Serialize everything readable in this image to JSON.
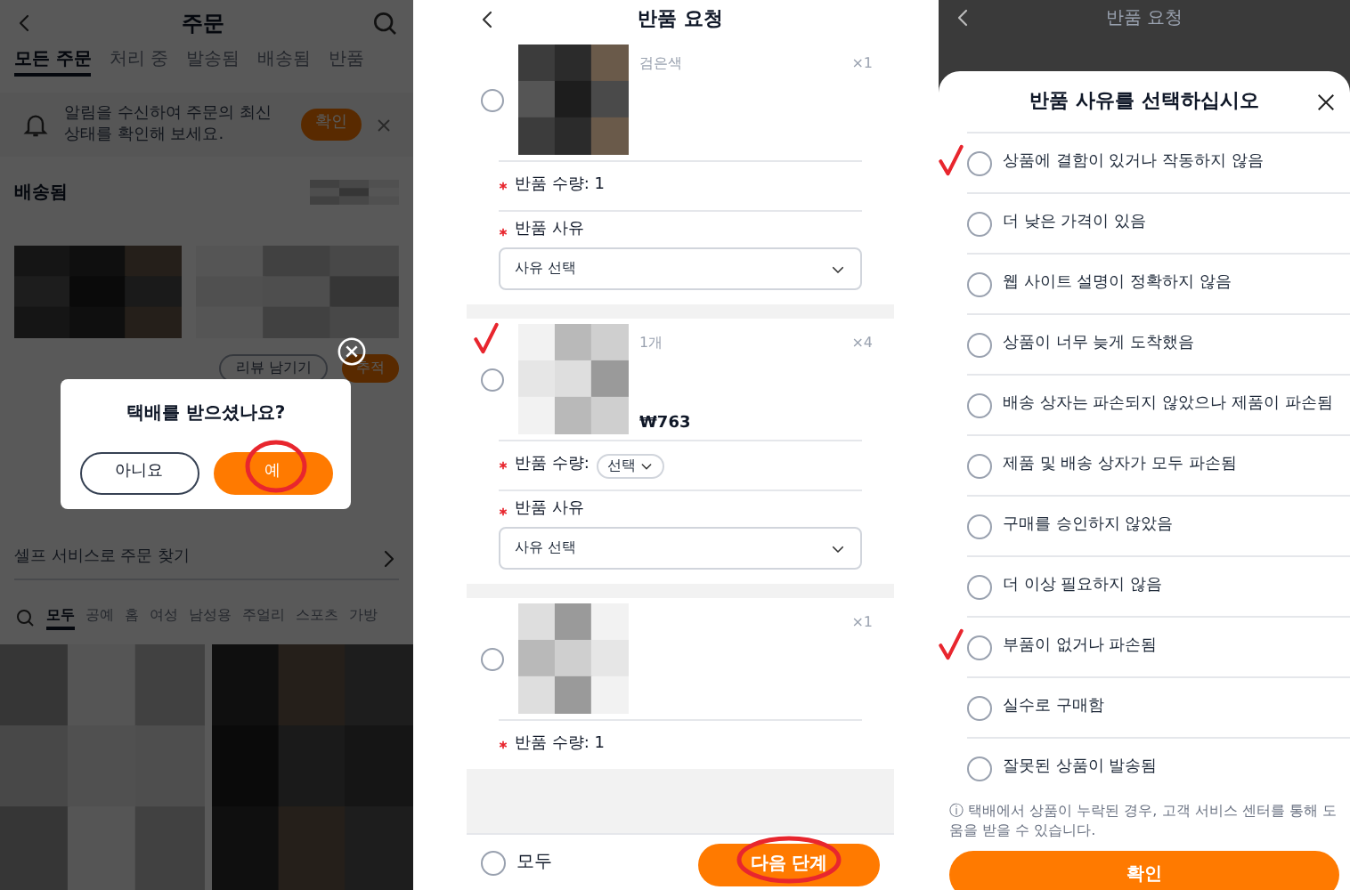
{
  "orders_screen": {
    "title": "주문",
    "tabs": [
      {
        "label": "모든 주문",
        "selected": true
      },
      {
        "label": "처리 중",
        "selected": false
      },
      {
        "label": "발송됨",
        "selected": false
      },
      {
        "label": "배송됨",
        "selected": false
      },
      {
        "label": "반품",
        "selected": false
      }
    ],
    "notice": {
      "text": "알림을 수신하여 주문의 최신 상태를 확인해 보세요.",
      "button": "확인"
    },
    "section": "배송됨",
    "order_buttons": [
      {
        "label": "리뷰 남기기",
        "kind": "outline"
      },
      {
        "label": "추적",
        "kind": "primary"
      }
    ],
    "self_service": "셀프 서비스로 주문 찾기",
    "categories": [
      {
        "label": "모두",
        "selected": true
      },
      {
        "label": "공예",
        "selected": false
      },
      {
        "label": "홈",
        "selected": false
      },
      {
        "label": "여성",
        "selected": false
      },
      {
        "label": "남성용",
        "selected": false
      },
      {
        "label": "주얼리",
        "selected": false
      },
      {
        "label": "스포츠",
        "selected": false
      },
      {
        "label": "가방",
        "selected": false
      }
    ],
    "dialog": {
      "question": "택배를 받으셨나요?",
      "buttons": [
        {
          "label": "아니요",
          "kind": "outline",
          "annotated": false
        },
        {
          "label": "예",
          "kind": "primary",
          "annotated": true
        }
      ]
    }
  },
  "return_screen": {
    "title": "반품 요청",
    "items": [
      {
        "variant": "검은색",
        "count": "×1",
        "qty_label": "반품 수량: 1",
        "reason_label": "반품 사유",
        "reason_select": "사유 선택",
        "required": true,
        "selected": false,
        "annotated": false
      },
      {
        "variant": "1개",
        "count": "×4",
        "price": "₩763",
        "qty_label": "반품 수량:",
        "qty_select": "선택",
        "reason_label": "반품 사유",
        "reason_select": "사유 선택",
        "required": true,
        "selected": false,
        "annotated": true
      },
      {
        "count": "×1",
        "qty_label": "반품 수량: 1",
        "required": true,
        "selected": false,
        "annotated": false
      }
    ],
    "select_all": {
      "label": "모두",
      "selected": false
    },
    "next_button": {
      "label": "다음 단계",
      "annotated": true
    }
  },
  "reason_sheet": {
    "background_title": "반품 요청",
    "title": "반품 사유를 선택하십시오",
    "options": [
      {
        "label": "상품에 결함이 있거나 작동하지 않음",
        "selected": false,
        "annotated": true
      },
      {
        "label": "더 낮은 가격이 있음",
        "selected": false,
        "annotated": false
      },
      {
        "label": "웹 사이트 설명이 정확하지 않음",
        "selected": false,
        "annotated": false
      },
      {
        "label": "상품이 너무 늦게 도착했음",
        "selected": false,
        "annotated": false
      },
      {
        "label": "배송 상자는 파손되지 않았으나 제품이 파손됨",
        "selected": false,
        "annotated": false
      },
      {
        "label": "제품 및 배송 상자가 모두 파손됨",
        "selected": false,
        "annotated": false
      },
      {
        "label": "구매를 승인하지 않았음",
        "selected": false,
        "annotated": false
      },
      {
        "label": "더 이상 필요하지 않음",
        "selected": false,
        "annotated": false
      },
      {
        "label": "부품이 없거나 파손됨",
        "selected": false,
        "annotated": true
      },
      {
        "label": "실수로 구매함",
        "selected": false,
        "annotated": false
      },
      {
        "label": "잘못된 상품이 발송됨",
        "selected": false,
        "annotated": false
      }
    ],
    "note": "ⓘ 택배에서 상품이 누락된 경우, 고객 서비스 센터를 통해 도움을 받을 수 있습니다.",
    "confirm": "확인"
  }
}
